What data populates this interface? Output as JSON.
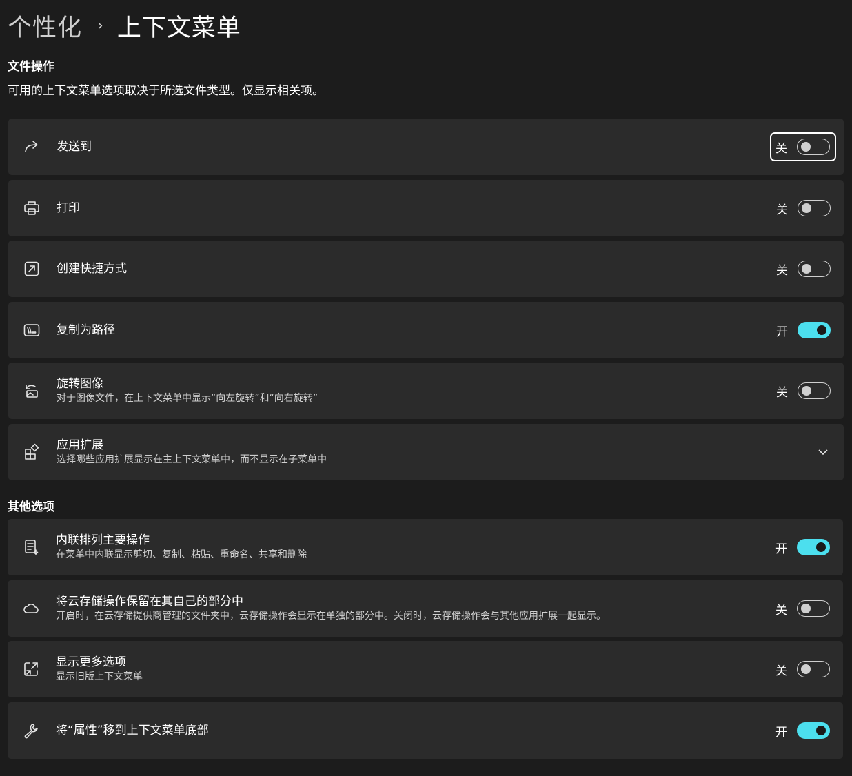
{
  "breadcrumb": {
    "parent": "个性化",
    "separator": "›",
    "current": "上下文菜单"
  },
  "file_ops": {
    "title": "文件操作",
    "description": "可用的上下文菜单选项取决于所选文件类型。仅显示相关项。",
    "items": [
      {
        "icon": "share-arrow-icon",
        "label": "发送到",
        "sub": "",
        "state": "关",
        "on": false
      },
      {
        "icon": "printer-icon",
        "label": "打印",
        "sub": "",
        "state": "关",
        "on": false
      },
      {
        "icon": "shortcut-icon",
        "label": "创建快捷方式",
        "sub": "",
        "state": "关",
        "on": false
      },
      {
        "icon": "copy-path-icon",
        "label": "复制为路径",
        "sub": "",
        "state": "开",
        "on": true
      },
      {
        "icon": "rotate-image-icon",
        "label": "旋转图像",
        "sub": "对于图像文件，在上下文菜单中显示“向左旋转”和“向右旋转”",
        "state": "关",
        "on": false
      },
      {
        "icon": "app-extensions-icon",
        "label": "应用扩展",
        "sub": "选择哪些应用扩展显示在主上下文菜单中，而不显示在子菜单中"
      }
    ]
  },
  "other_options": {
    "title": "其他选项",
    "items": [
      {
        "icon": "inline-list-icon",
        "label": "内联排列主要操作",
        "sub": "在菜单中内联显示剪切、复制、粘贴、重命名、共享和删除",
        "state": "开",
        "on": true
      },
      {
        "icon": "cloud-icon",
        "label": "将云存储操作保留在其自己的部分中",
        "sub": "开启时，在云存储提供商管理的文件夹中，云存储操作会显示在单独的部分中。关闭时，云存储操作会与其他应用扩展一起显示。",
        "state": "关",
        "on": false
      },
      {
        "icon": "expand-window-icon",
        "label": "显示更多选项",
        "sub": "显示旧版上下文菜单",
        "state": "关",
        "on": false
      },
      {
        "icon": "wrench-icon",
        "label": "将“属性”移到上下文菜单底部",
        "sub": "",
        "state": "开",
        "on": true
      }
    ]
  },
  "colors": {
    "background": "#1c1c1c",
    "card": "#2b2b2b",
    "accent": "#4cdfee"
  }
}
